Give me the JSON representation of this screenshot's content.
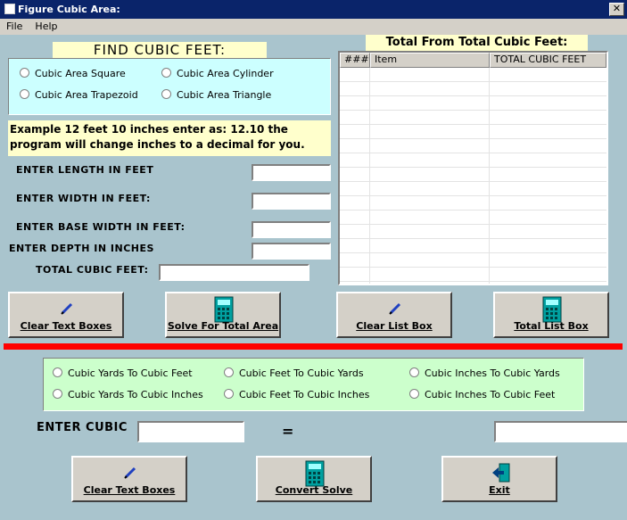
{
  "window": {
    "title": "Figure Cubic Area:",
    "close": "✕"
  },
  "menu": [
    "File",
    "Help"
  ],
  "find": {
    "heading": "FIND CUBIC FEET:",
    "options": [
      "Cubic Area Square",
      "Cubic Area Cylinder",
      "Cubic Area Trapezoid",
      "Cubic Area Triangle"
    ]
  },
  "example": [
    "Example 12 feet 10 inches enter as: 12.10  the",
    "program will change inches to a decimal for you."
  ],
  "inputs": {
    "length": "ENTER LENGTH IN FEET",
    "width": "ENTER  WIDTH  IN  FEET:",
    "base": "ENTER  BASE WIDTH  IN  FEET:",
    "depth": "ENTER  DEPTH  IN  INCHES",
    "total": "TOTAL  CUBIC FEET:"
  },
  "list": {
    "heading": "Total From Total Cubic  Feet:",
    "columns": [
      "###",
      "Item",
      "TOTAL CUBIC FEET"
    ]
  },
  "buttons": {
    "clear_text": "Clear Text Boxes",
    "solve": "Solve For Total Area",
    "clear_list": "Clear List Box",
    "total_list": "Total List Box",
    "clear_text2": "Clear Text Boxes",
    "convert": "Convert Solve",
    "exit": "Exit"
  },
  "convert": {
    "options": [
      "Cubic Yards To Cubic Feet",
      "Cubic Feet To Cubic  Yards",
      "Cubic Inches To Cubic Yards",
      "Cubic Yards To Cubic Inches",
      "Cubic Feet To Cubic Inches",
      "Cubic Inches To Cubic Feet"
    ],
    "enter_label": "ENTER CUBIC",
    "equals": "="
  },
  "colors": {
    "divider": "#ff0000",
    "background": "#a9c4cd"
  }
}
